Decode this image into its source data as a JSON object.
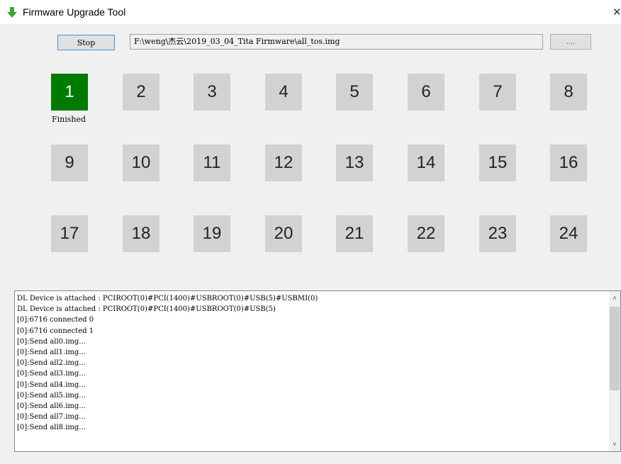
{
  "window": {
    "title": "Firmware Upgrade Tool",
    "close_glyph": "✕"
  },
  "toolbar": {
    "stop_label": "Stop",
    "path_value": "F:\\weng\\杰云\\2019_03_04_Tita Firmware\\all_tos.img",
    "browse_label": "...."
  },
  "devices": [
    {
      "label": "1",
      "status": "Finished"
    },
    {
      "label": "2",
      "status": ""
    },
    {
      "label": "3",
      "status": ""
    },
    {
      "label": "4",
      "status": ""
    },
    {
      "label": "5",
      "status": ""
    },
    {
      "label": "6",
      "status": ""
    },
    {
      "label": "7",
      "status": ""
    },
    {
      "label": "8",
      "status": ""
    },
    {
      "label": "9",
      "status": ""
    },
    {
      "label": "10",
      "status": ""
    },
    {
      "label": "11",
      "status": ""
    },
    {
      "label": "12",
      "status": ""
    },
    {
      "label": "13",
      "status": ""
    },
    {
      "label": "14",
      "status": ""
    },
    {
      "label": "15",
      "status": ""
    },
    {
      "label": "16",
      "status": ""
    },
    {
      "label": "17",
      "status": ""
    },
    {
      "label": "18",
      "status": ""
    },
    {
      "label": "19",
      "status": ""
    },
    {
      "label": "20",
      "status": ""
    },
    {
      "label": "21",
      "status": ""
    },
    {
      "label": "22",
      "status": ""
    },
    {
      "label": "23",
      "status": ""
    },
    {
      "label": "24",
      "status": ""
    }
  ],
  "log": [
    "DL Device is attached : PCIROOT(0)#PCI(1400)#USBROOT(0)#USB(5)#USBMI(0)",
    "DL Device is attached : PCIROOT(0)#PCI(1400)#USBROOT(0)#USB(5)",
    "[0]:6716 connected 0",
    "[0]:6716 connected 1",
    "[0]:Send all0.img...",
    "[0]:Send all1.img...",
    "[0]:Send all2.img...",
    "[0]:Send all3.img...",
    "[0]:Send all4.img...",
    "[0]:Send all5.img...",
    "[0]:Send all6.img...",
    "[0]:Send all7.img...",
    "[0]:Send all8.img..."
  ],
  "colors": {
    "finished": "#007a00",
    "idle": "#d2d2d2",
    "accent": "#4a90d9"
  },
  "icons": {
    "app": "green-down-arrow-icon",
    "scroll_up": "chevron-up-icon",
    "scroll_down": "chevron-down-icon"
  }
}
